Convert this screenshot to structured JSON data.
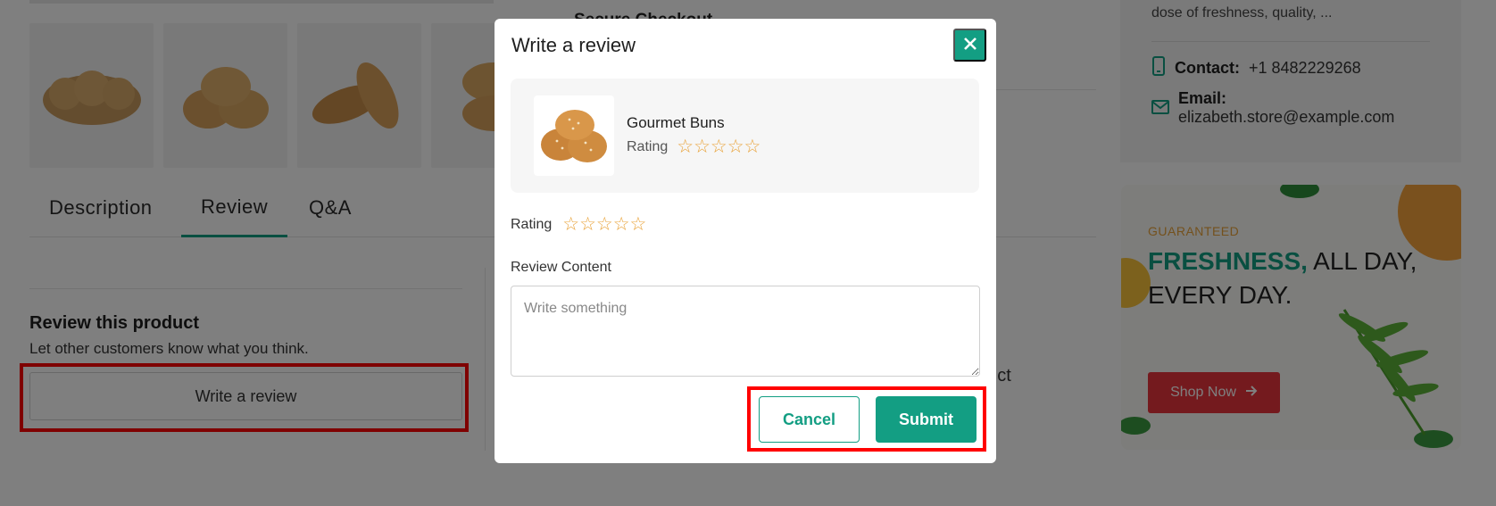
{
  "background": {
    "secure_checkout": "Secure Checkout",
    "tabs": [
      {
        "label": "Description",
        "active": false
      },
      {
        "label": "Review",
        "active": true
      },
      {
        "label": "Q&A",
        "active": false
      }
    ],
    "review_section": {
      "title": "Review this product",
      "subtitle": "Let other customers know what you think.",
      "write_button": "Write a review"
    },
    "partial_text": "duct",
    "store_info": {
      "description": "dose of freshness, quality, ...",
      "contact_label": "Contact:",
      "contact_value": "+1 8482229268",
      "email_label": "Email:",
      "email_value": "elizabeth.store@example.com"
    },
    "banner": {
      "eyebrow": "GUARANTEED",
      "headline_accent": "FRESHNESS,",
      "headline_rest": "ALL DAY,",
      "headline_line2": "EVERY DAY.",
      "button": "Shop Now"
    }
  },
  "modal": {
    "title": "Write a review",
    "product": {
      "name": "Gourmet Buns",
      "rating_label": "Rating",
      "stars": "☆☆☆☆☆"
    },
    "rating_label": "Rating",
    "rating_stars": "☆☆☆☆☆",
    "review_content_label": "Review Content",
    "review_placeholder": "Write something",
    "review_value": "",
    "cancel_label": "Cancel",
    "submit_label": "Submit"
  },
  "colors": {
    "accent": "#139e83",
    "star": "#e9a33a",
    "shop_now": "#e8343c",
    "highlight": "#ff0000"
  },
  "icons": [
    "close-icon",
    "phone-icon",
    "mail-icon",
    "arrow-right-icon"
  ]
}
